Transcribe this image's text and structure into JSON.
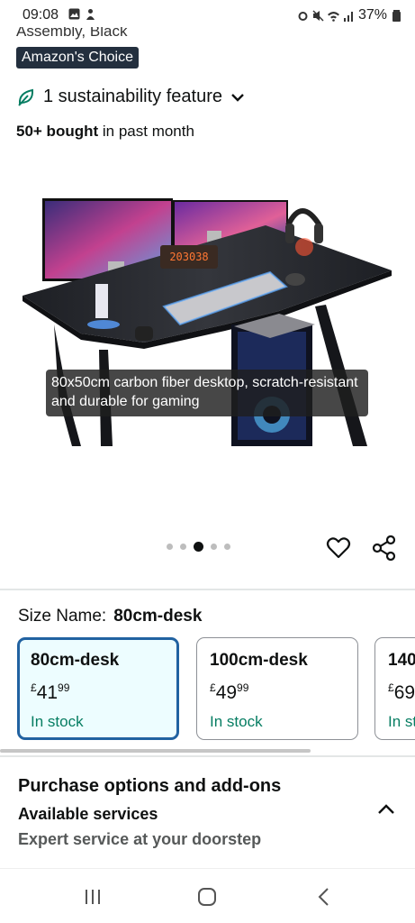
{
  "status_bar": {
    "time": "09:08",
    "battery": "37%"
  },
  "product": {
    "subtitle_fragment": "Assembly, Black",
    "badge": "Amazon's Choice",
    "sustainability": "1 sustainability feature",
    "bought_bold": "50+ bought",
    "bought_rest": " in past month",
    "image_caption": "80x50cm carbon fiber desktop, scratch-resistant and durable for gaming",
    "image_pager": {
      "count": 5,
      "active_index": 2
    },
    "clock_digits": "203038"
  },
  "size": {
    "label": "Size Name:",
    "selected": "80cm-desk",
    "options": [
      {
        "name": "80cm-desk",
        "currency": "£",
        "whole": "41",
        "fraction": "99",
        "stock": "In stock"
      },
      {
        "name": "100cm-desk",
        "currency": "£",
        "whole": "49",
        "fraction": "99",
        "stock": "In stock"
      },
      {
        "name": "140",
        "currency": "£",
        "whole": "69",
        "fraction": "",
        "stock": "In st"
      }
    ]
  },
  "purchase": {
    "title": "Purchase options and add-ons",
    "available": "Available services",
    "expert": "Expert service at your doorstep"
  },
  "colors": {
    "accent": "#2162a1",
    "stock": "#067d62",
    "badge": "#232f3e"
  }
}
